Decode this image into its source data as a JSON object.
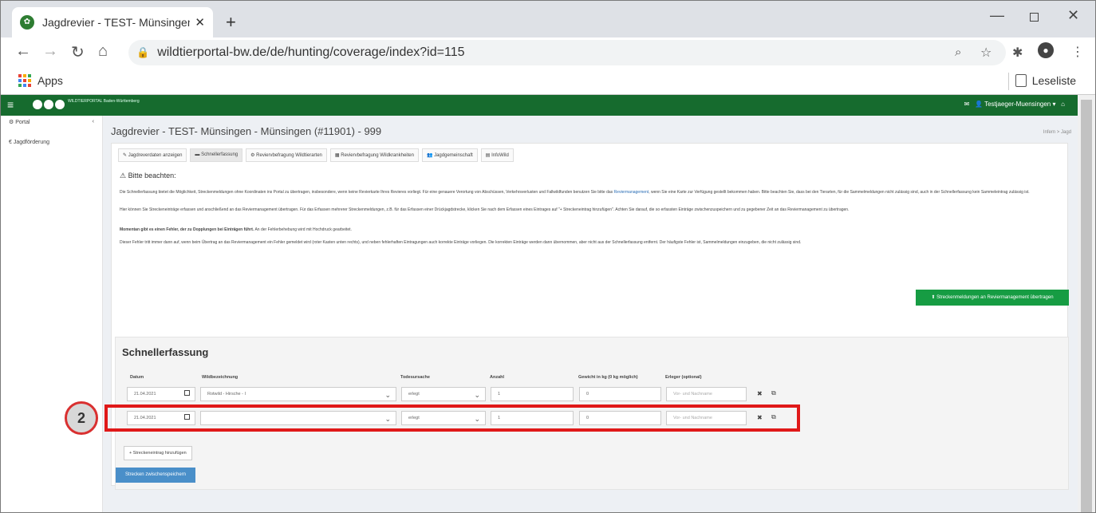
{
  "browser": {
    "tab_title": "Jagdrevier - TEST- Münsingen - M",
    "url": "wildtierportal-bw.de/de/hunting/coverage/index?id=115",
    "bookmarks_apps": "Apps",
    "reading_list": "Leseliste"
  },
  "app": {
    "brand_text": "WILDTIERPORTAL Baden-Württemberg",
    "user_label": "Testjaeger-Muensingen",
    "colors": {
      "nav": "#166b2e",
      "accent_green": "#169c43",
      "blue": "#4a8fc9",
      "highlight": "#e01919"
    },
    "sidebar": [
      {
        "label": "Portal"
      },
      {
        "label": "Jagdförderung"
      }
    ],
    "page_title": "Jagdrevier - TEST- Münsingen - Münsingen (#11901) - 999",
    "breadcrumbs": "Infern > Jagd",
    "tabs": [
      {
        "label": "Jagdreverdaten anzeigen"
      },
      {
        "label": "Schnellerfassung"
      },
      {
        "label": "Reviervbefragung Wildtierarten"
      },
      {
        "label": "Reviervbefragung Wildkrankheiten"
      },
      {
        "label": "Jagdgemeinschaft"
      },
      {
        "label": "InfoWild"
      }
    ],
    "notice": {
      "title": "Bitte beachten:",
      "p1": "Die Schnellerfassung bietet die Möglichkeit, Streckenmeldungen ohne Koordinaten ins Portal zu übertragen, insbesondere, wenn keine Revierkarte Ihres Revieres vorliegt. Für eine genauere Verortung von Abschüssen, Verkehrsverlusten und Fallwildfunden benutzen Sie bitte das",
      "p1_link": "Reviermanagement",
      "p1_end": ", wenn Sie eine Karte zur Verfügung gestellt bekommen haben. Bitte beachten Sie, dass bei den Tierarten, für die Sammelmeldungen nicht zulässig sind, auch in der Schnellerfassung kein Sammeleintrag zulässig ist.",
      "p2": "Hier können Sie Streckeneinträge erfassen und anschließend an das Reviermanagement übertragen. Für das Erfassen mehrerer Streckenmeldungen, z.B. für das Erfassen einer Drückjagdstrecke, klicken Sie nach dem Erfassen eines Eintrages auf \"+ Streckeneintrag hinzufügen\". Achten Sie darauf, die so erfassten Einträge zwischenzuspeichern und zu gegebener Zeit an das Reviermanagement zu übertragen.",
      "p3_bold": "Momentan gibt es einen Fehler, der zu Dopplungen bei Einträgen führt.",
      "p3": " An der Fehlerbehebung wird mit Hochdruck gearbeitet.",
      "p4": "Dieser Fehler tritt immer dann auf, wenn beim Übertrag an das Reviermanagement ein Fehler gemeldet wird (roter Kasten unten rechts), und neben fehlerhaften Eintragungen auch korrekte Einträge vorliegen. Die korrekten Einträge werden dann übernommen, aber nicht aus der Schnellerfassung entfernt. Der häufigste Fehler ist, Sammelmeldungen einzugeben, die nicht zulässig sind."
    },
    "transfer_button": "Streckenmeldungen an Reviermanagement übertragen",
    "quick_entry": {
      "title": "Schnellerfassung",
      "columns": [
        "Datum",
        "Wildbezeichnung",
        "Todesursache",
        "Anzahl",
        "Gewicht in kg (0 kg möglich)",
        "Erleger (optional)"
      ],
      "rows": [
        {
          "date": "21.04.2021",
          "species": "Rotwild - Hirsche - I",
          "cause": "erlegt",
          "count": "1",
          "weight": "0",
          "hunter_placeholder": "Vor- und Nachname"
        },
        {
          "date": "21.04.2021",
          "species": "",
          "cause": "erlegt",
          "count": "1",
          "weight": "0",
          "hunter_placeholder": "Vor- und Nachname"
        }
      ],
      "add_button": "Streckeneintrag hinzufügen",
      "save_button": "Strecken zwischenspeichern"
    },
    "annotation": {
      "step": "2"
    }
  }
}
